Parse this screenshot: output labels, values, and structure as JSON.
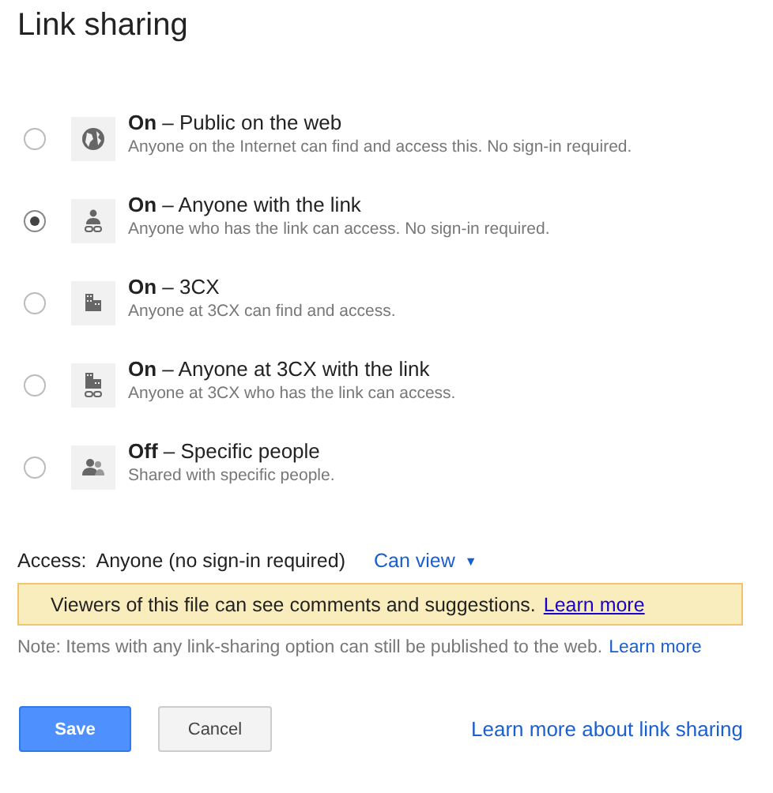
{
  "title": "Link sharing",
  "options": [
    {
      "kind": "globe",
      "label": "**On** – Public on the web",
      "description": "Anyone on the Internet can find and access this. No sign-in required.",
      "selected": false
    },
    {
      "kind": "person-link",
      "label": "**On** – Anyone with the link",
      "description": "Anyone who has the link can access. No sign-in required.",
      "selected": true
    },
    {
      "kind": "building",
      "label": "**On** – 3CX",
      "description": "Anyone at 3CX can find and access.",
      "selected": false
    },
    {
      "kind": "building-link",
      "label": "**On** – Anyone at 3CX with the link",
      "description": "Anyone at 3CX who has the link can access.",
      "selected": false
    },
    {
      "kind": "people",
      "label": "**Off** – Specific people",
      "description": "Shared with specific people.",
      "selected": false
    }
  ],
  "access": {
    "label": "Access:",
    "value": "Anyone (no sign-in required)",
    "permission": "Can view",
    "caret": "▼"
  },
  "banner": {
    "text": "Viewers of this file can see comments and suggestions.",
    "link": "Learn more"
  },
  "note": {
    "text": "Note: Items with any link-sharing option can still be published to the web.",
    "link": "Learn more"
  },
  "buttons": {
    "save": "Save",
    "cancel": "Cancel"
  },
  "footer_link": "Learn more about link sharing"
}
